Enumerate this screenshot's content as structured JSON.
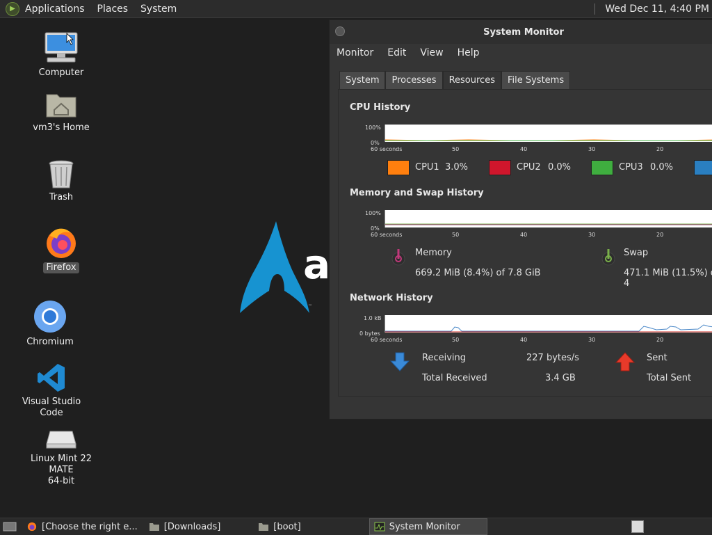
{
  "top_panel": {
    "menus": [
      "Applications",
      "Places",
      "System"
    ],
    "clock": "Wed Dec 11,  4:40 PM"
  },
  "desktop": {
    "icons": [
      {
        "label": "Computer"
      },
      {
        "label": "vm3's Home"
      },
      {
        "label": "Trash"
      },
      {
        "label": "Firefox"
      },
      {
        "label": "Chromium"
      },
      {
        "label": "Visual Studio Code"
      },
      {
        "label": "Linux Mint 22 MATE\n64-bit"
      }
    ],
    "wallpaper_text": "a"
  },
  "window": {
    "title": "System Monitor",
    "menu": [
      "Monitor",
      "Edit",
      "View",
      "Help"
    ],
    "tabs": [
      "System",
      "Processes",
      "Resources",
      "File Systems"
    ],
    "active_tab": "Resources",
    "cpu": {
      "title": "CPU History",
      "y_max": "100%",
      "y_min": "0%",
      "x_ticks": [
        "60 seconds",
        "50",
        "40",
        "30",
        "20"
      ],
      "legend": [
        {
          "name": "CPU1",
          "value": "3.0%",
          "color": "#ff7f0e"
        },
        {
          "name": "CPU2",
          "value": "0.0%",
          "color": "#d0162c"
        },
        {
          "name": "CPU3",
          "value": "0.0%",
          "color": "#3fae3f"
        },
        {
          "name": "",
          "value": "",
          "color": "#2a7fc1"
        }
      ]
    },
    "memory": {
      "title": "Memory and Swap History",
      "y_max": "100%",
      "y_min": "0%",
      "x_ticks": [
        "60 seconds",
        "50",
        "40",
        "30",
        "20"
      ],
      "memory_label": "Memory",
      "memory_value": "669.2 MiB (8.4%) of 7.8 GiB",
      "swap_label": "Swap",
      "swap_value": "471.1 MiB (11.5%) of 4"
    },
    "network": {
      "title": "Network History",
      "y_max": "1.0 kB",
      "y_min": "0 bytes",
      "x_ticks": [
        "60 seconds",
        "50",
        "40",
        "30",
        "20"
      ],
      "receiving_label": "Receiving",
      "receiving_value": "227 bytes/s",
      "total_received_label": "Total Received",
      "total_received_value": "3.4 GB",
      "sent_label": "Sent",
      "total_sent_label": "Total Sent"
    }
  },
  "taskbar": {
    "tasks": [
      "[Choose the right e...",
      "[Downloads]",
      "[boot]",
      "System Monitor"
    ]
  }
}
